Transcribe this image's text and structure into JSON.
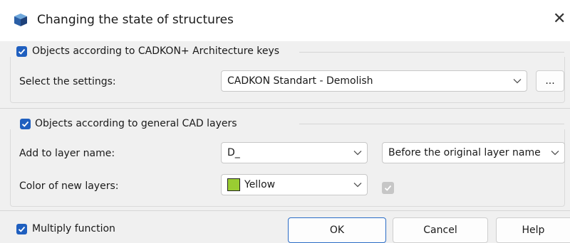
{
  "window": {
    "title": "Changing the state of structures",
    "close_glyph": "✕"
  },
  "group_cadkon": {
    "checkbox_label": "Objects according to CADKON+ Architecture keys",
    "checked": true,
    "settings_label": "Select the settings:",
    "settings_value": "CADKON Standart - Demolish",
    "browse_label": "..."
  },
  "group_cad": {
    "checkbox_label": "Objects according to general CAD layers",
    "checked": true,
    "layer_label": "Add to layer name:",
    "layer_value": "D_",
    "position_value": "Before the original layer name",
    "color_label": "Color of new layers:",
    "color_value": "Yellow",
    "color_swatch": "#9acd32",
    "extra_checkbox_checked": true,
    "extra_checkbox_enabled": false
  },
  "footer": {
    "multiply_label": "Multiply function",
    "multiply_checked": true,
    "ok_label": "OK",
    "cancel_label": "Cancel",
    "help_label": "Help"
  },
  "colors": {
    "accent": "#1f5fbf",
    "disabled": "#c6c6c6",
    "background": "#f0f0f0"
  }
}
